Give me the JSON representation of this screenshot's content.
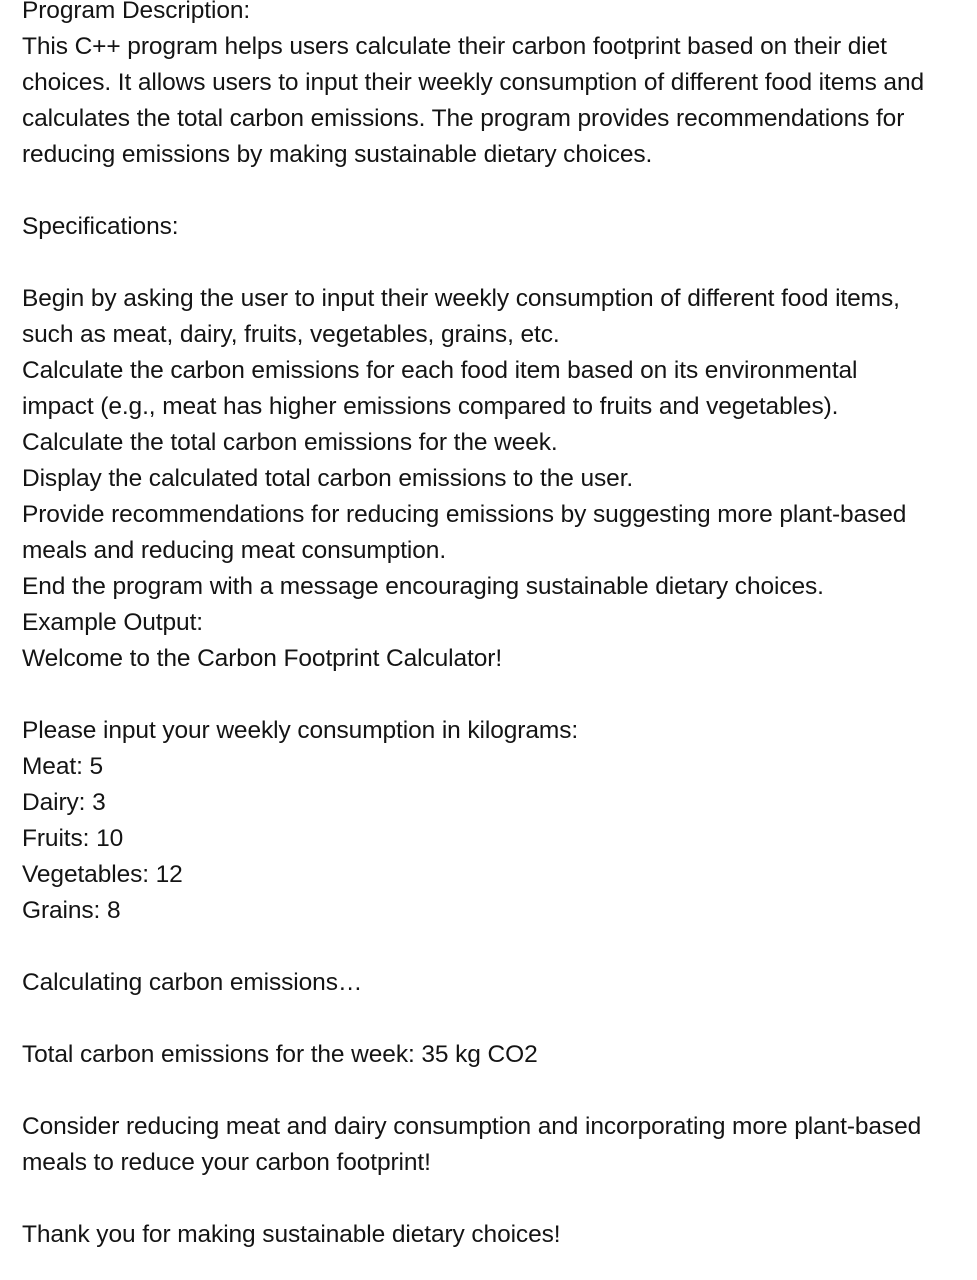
{
  "document": {
    "background_color": "#ffffff",
    "text_color": "#141414",
    "blocks": [
      {
        "id": "program-description-heading",
        "lines": [
          "Program Description:"
        ]
      },
      {
        "id": "program-description-body",
        "lines": [
          "This C++ program helps users calculate their carbon footprint based on their diet choices. It allows users to input their weekly consumption of different food items and calculates the total carbon emissions. The program provides recommendations for reducing emissions by making sustainable dietary choices."
        ]
      },
      {
        "id": "specifications-heading",
        "lines": [
          "Specifications:"
        ]
      },
      {
        "id": "specifications-list",
        "lines": [
          "Begin by asking the user to input their weekly consumption of different food items, such as meat, dairy, fruits, vegetables, grains, etc.",
          "Calculate the carbon emissions for each food item based on its environmental impact (e.g., meat has higher emissions compared to fruits and vegetables).",
          "Calculate the total carbon emissions for the week.",
          "Display the calculated total carbon emissions to the user.",
          "Provide recommendations for reducing emissions by suggesting more plant-based meals and reducing meat consumption.",
          "End the program with a message encouraging sustainable dietary choices.",
          "Example Output:",
          "Welcome to the Carbon Footprint Calculator!"
        ]
      },
      {
        "id": "example-input-prompt",
        "lines": [
          "Please input your weekly consumption in kilograms:",
          "Meat: 5",
          "Dairy: 3",
          "Fruits: 10",
          "Vegetables: 12",
          "Grains: 8"
        ]
      },
      {
        "id": "calculating-status",
        "lines": [
          "Calculating carbon emissions…"
        ]
      },
      {
        "id": "total-emissions-result",
        "lines": [
          "Total carbon emissions for the week: 35 kg CO2"
        ]
      },
      {
        "id": "recommendation-message",
        "lines": [
          "Consider reducing meat and dairy consumption and incorporating more plant-based meals to reduce your carbon footprint!"
        ]
      },
      {
        "id": "closing-message",
        "lines": [
          "Thank you for making sustainable dietary choices!"
        ]
      }
    ],
    "example_output": {
      "title": "Welcome to the Carbon Footprint Calculator!",
      "input_prompt": "Please input your weekly consumption in kilograms:",
      "inputs": [
        {
          "label": "Meat",
          "value": "5"
        },
        {
          "label": "Dairy",
          "value": "3"
        },
        {
          "label": "Fruits",
          "value": "10"
        },
        {
          "label": "Vegetables",
          "value": "12"
        },
        {
          "label": "Grains",
          "value": "8"
        }
      ],
      "status": "Calculating carbon emissions…",
      "total_label": "Total carbon emissions for the week:",
      "total_value": "35 kg CO2",
      "recommendation": "Consider reducing meat and dairy consumption and incorporating more plant-based meals to reduce your carbon footprint!",
      "closing": "Thank you for making sustainable dietary choices!"
    }
  }
}
